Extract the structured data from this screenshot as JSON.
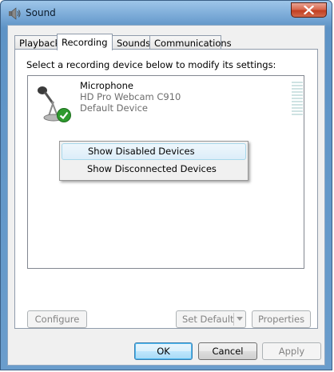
{
  "window": {
    "title": "Sound"
  },
  "tabs": [
    {
      "label": "Playback",
      "active": false
    },
    {
      "label": "Recording",
      "active": true
    },
    {
      "label": "Sounds",
      "active": false
    },
    {
      "label": "Communications",
      "active": false
    }
  ],
  "instructions": "Select a recording device below to modify its settings:",
  "device": {
    "name": "Microphone",
    "description": "HD Pro Webcam C910",
    "status": "Default Device",
    "icon": "microphone-icon",
    "status_icon": "checkmark-icon"
  },
  "context_menu": {
    "items": [
      {
        "label": "Show Disabled Devices",
        "highlighted": true
      },
      {
        "label": "Show Disconnected Devices",
        "highlighted": false
      }
    ]
  },
  "panel_buttons": {
    "configure": "Configure",
    "set_default": "Set Default",
    "properties": "Properties"
  },
  "dialog_buttons": {
    "ok": "OK",
    "cancel": "Cancel",
    "apply": "Apply"
  },
  "colors": {
    "accent": "#3c7fb1",
    "status_green": "#2f9a2f",
    "close_red": "#c13f22"
  }
}
